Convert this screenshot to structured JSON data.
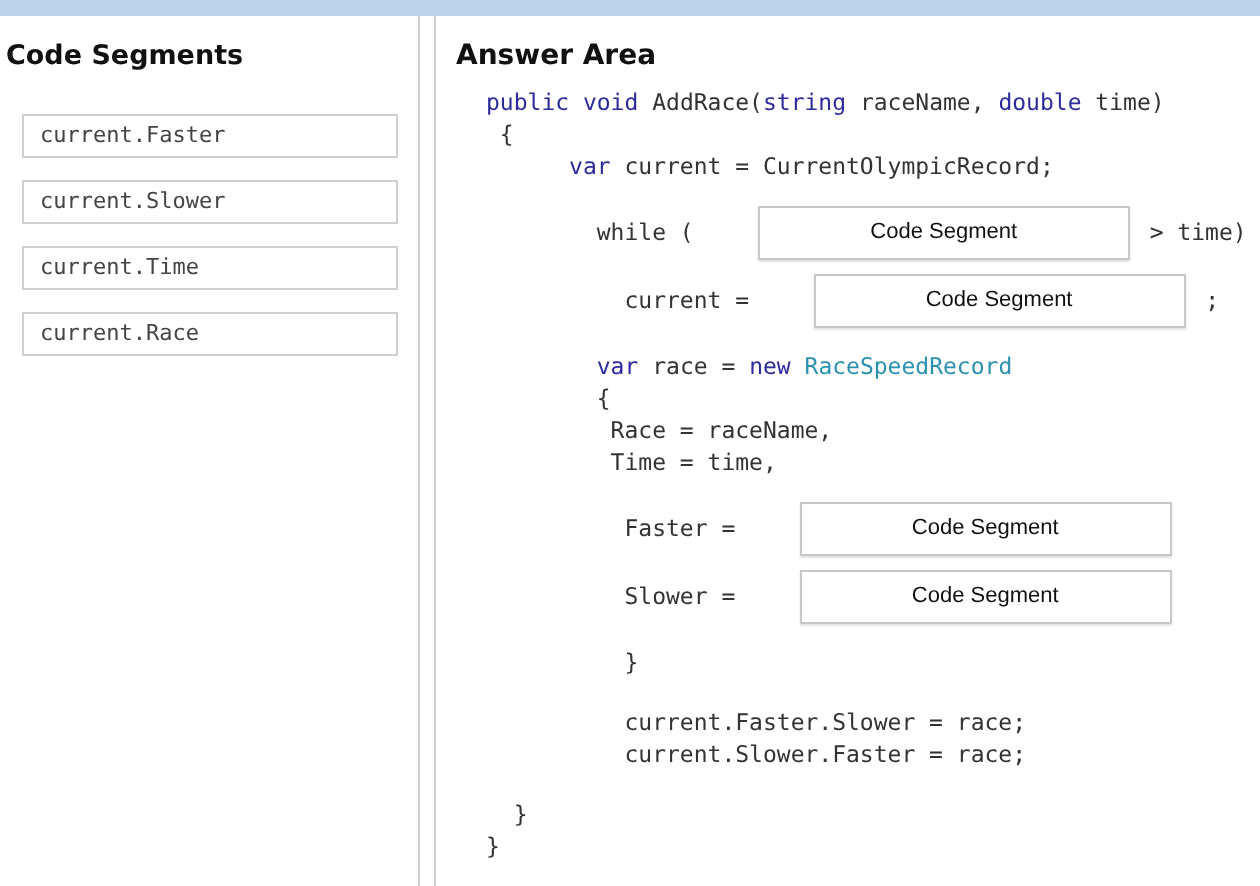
{
  "code_segments": {
    "title": "Code Segments",
    "items": [
      "current.Faster",
      "current.Slower",
      "current.Time",
      "current.Race"
    ]
  },
  "answer_area": {
    "title": "Answer Area",
    "lines": [
      {
        "kind": "code",
        "tokens": [
          {
            "text": "public void",
            "kind": "keyword"
          },
          {
            "text": " AddRace(",
            "kind": "plain"
          },
          {
            "text": "string",
            "kind": "keyword"
          },
          {
            "text": " raceName, ",
            "kind": "plain"
          },
          {
            "text": "double",
            "kind": "keyword"
          },
          {
            "text": " time)",
            "kind": "plain"
          }
        ]
      },
      {
        "kind": "code",
        "tokens": [
          {
            "text": " {",
            "kind": "plain"
          }
        ]
      },
      {
        "kind": "code",
        "tokens": [
          {
            "text": "      var",
            "kind": "keyword"
          },
          {
            "text": " current = CurrentOlympicRecord;",
            "kind": "plain"
          }
        ]
      },
      {
        "kind": "slot",
        "prefix": "        while (",
        "slot": "Code Segment",
        "suffix": "> time)"
      },
      {
        "kind": "slot",
        "prefix": "          current =",
        "slot": "Code Segment",
        "suffix": ";"
      },
      {
        "kind": "code",
        "tokens": [
          {
            "text": "        var",
            "kind": "keyword"
          },
          {
            "text": " race = ",
            "kind": "plain"
          },
          {
            "text": "new ",
            "kind": "keyword"
          },
          {
            "text": "RaceSpeedRecord",
            "kind": "type"
          }
        ]
      },
      {
        "kind": "code",
        "tokens": [
          {
            "text": "        {",
            "kind": "plain"
          }
        ]
      },
      {
        "kind": "code",
        "tokens": [
          {
            "text": "         Race = raceName,",
            "kind": "plain"
          }
        ]
      },
      {
        "kind": "code",
        "tokens": [
          {
            "text": "         Time = time,",
            "kind": "plain"
          }
        ]
      },
      {
        "kind": "slot",
        "prefix": "          Faster =",
        "slot": "Code Segment"
      },
      {
        "kind": "slot",
        "prefix": "          Slower =",
        "slot": "Code Segment"
      },
      {
        "kind": "code",
        "tokens": [
          {
            "text": "          }",
            "kind": "plain"
          }
        ]
      },
      {
        "kind": "blank"
      },
      {
        "kind": "code",
        "tokens": [
          {
            "text": "          current.Faster.Slower = race;",
            "kind": "plain"
          }
        ]
      },
      {
        "kind": "code",
        "tokens": [
          {
            "text": "          current.Slower.Faster = race;",
            "kind": "plain"
          }
        ]
      },
      {
        "kind": "blank"
      },
      {
        "kind": "code",
        "tokens": [
          {
            "text": "  }",
            "kind": "plain"
          }
        ]
      },
      {
        "kind": "code",
        "tokens": [
          {
            "text": "}",
            "kind": "plain"
          }
        ]
      }
    ]
  }
}
